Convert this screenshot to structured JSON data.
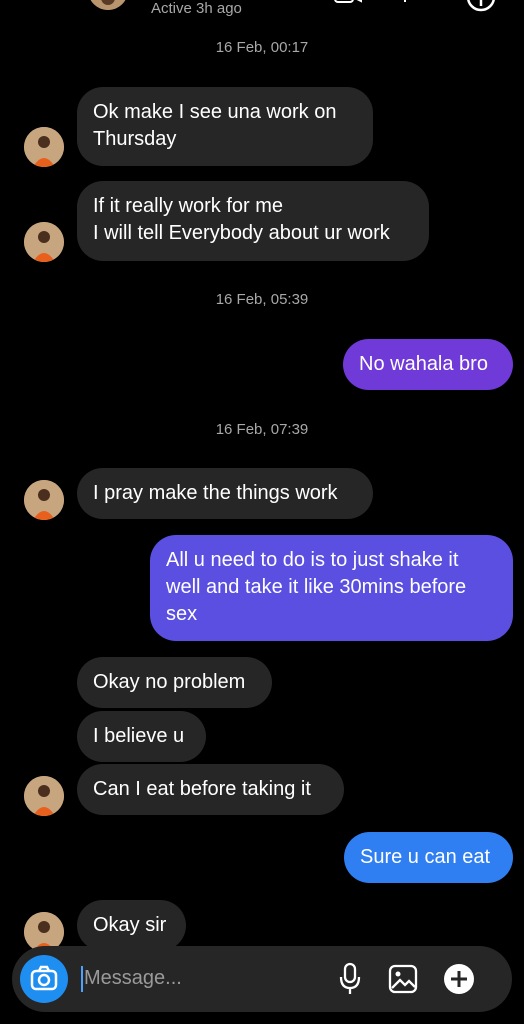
{
  "header": {
    "status": "Active 3h ago"
  },
  "timestamps": [
    "16 Feb, 00:17",
    "16 Feb, 05:39",
    "16 Feb, 07:39"
  ],
  "messages": [
    {
      "from": "them",
      "lines": [
        "Ok make I see una work on",
        "Thursday"
      ]
    },
    {
      "from": "them",
      "lines": [
        "If it really work for me",
        "I will tell Everybody about ur work"
      ]
    },
    {
      "from": "me",
      "lines": [
        "No wahala bro"
      ]
    },
    {
      "from": "them",
      "lines": [
        "I pray make the things work"
      ]
    },
    {
      "from": "me",
      "lines": [
        "All u need to do is to just shake it",
        "well and take it like 30mins before",
        "sex"
      ]
    },
    {
      "from": "them",
      "lines": [
        "Okay no problem"
      ]
    },
    {
      "from": "them",
      "lines": [
        "I believe u"
      ]
    },
    {
      "from": "them",
      "lines": [
        "Can I eat before taking it"
      ]
    },
    {
      "from": "me",
      "lines": [
        "Sure u can eat"
      ]
    },
    {
      "from": "them",
      "lines": [
        "Okay sir"
      ]
    }
  ],
  "composer": {
    "placeholder": "Message..."
  },
  "colors": {
    "background": "#000000",
    "incoming": "#262626",
    "outgoing_purple": "#6f3ad8",
    "outgoing_indigo": "#5a4fe0",
    "outgoing_blue": "#2f7ff2",
    "camera_button": "#1f8ef1"
  },
  "icons": [
    "back-arrow-icon",
    "video-call-icon",
    "phone-icon",
    "info-icon",
    "camera-icon",
    "microphone-icon",
    "gallery-icon",
    "plus-icon"
  ]
}
